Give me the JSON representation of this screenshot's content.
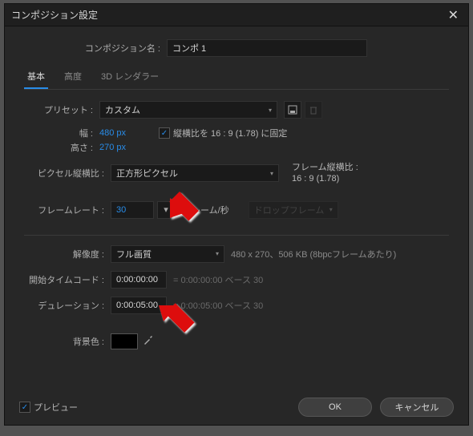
{
  "dialog": {
    "title": "コンポジション設定",
    "close": "✕"
  },
  "comp": {
    "name_label": "コンポジション名 :",
    "name_value": "コンポ 1"
  },
  "tabs": {
    "basic": "基本",
    "advanced": "高度",
    "renderer": "3D レンダラー"
  },
  "preset": {
    "label": "プリセット :",
    "value": "カスタム"
  },
  "width": {
    "label": "幅 :",
    "value": "480",
    "unit": "px"
  },
  "height": {
    "label": "高さ :",
    "value": "270",
    "unit": "px"
  },
  "lock_aspect": {
    "label": "縦横比を 16 : 9 (1.78) に固定"
  },
  "pixel_aspect": {
    "label": "ピクセル縦横比 :",
    "value": "正方形ピクセル",
    "frame_label": "フレーム縦横比 :",
    "frame_value": "16 : 9 (1.78)"
  },
  "framerate": {
    "label": "フレームレート :",
    "value": "30",
    "note": "フレーム/秒",
    "drop": "ドロップフレーム"
  },
  "resolution": {
    "label": "解像度 :",
    "value": "フル画質",
    "note": "480 x 270、506 KB (8bpcフレームあたり)"
  },
  "start_tc": {
    "label": "開始タイムコード :",
    "value": "0:00:00:00",
    "note": "= 0:00:00:00  ベース 30"
  },
  "duration": {
    "label": "デュレーション :",
    "value": "0:00:05:00",
    "note": "= 0:00:05:00  ベース 30"
  },
  "bgcolor": {
    "label": "背景色 :"
  },
  "footer": {
    "preview": "プレビュー",
    "ok": "OK",
    "cancel": "キャンセル"
  }
}
